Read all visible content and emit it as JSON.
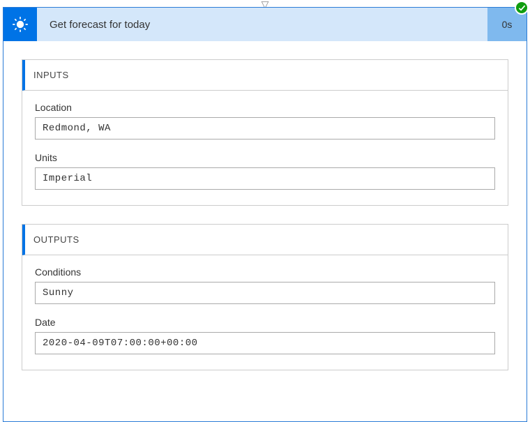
{
  "header": {
    "title": "Get forecast for today",
    "duration": "0s"
  },
  "sections": {
    "inputs": {
      "title": "INPUTS",
      "fields": {
        "location": {
          "label": "Location",
          "value": "Redmond, WA"
        },
        "units": {
          "label": "Units",
          "value": "Imperial"
        }
      }
    },
    "outputs": {
      "title": "OUTPUTS",
      "fields": {
        "conditions": {
          "label": "Conditions",
          "value": "Sunny"
        },
        "date": {
          "label": "Date",
          "value": "2020-04-09T07:00:00+00:00"
        }
      }
    }
  }
}
